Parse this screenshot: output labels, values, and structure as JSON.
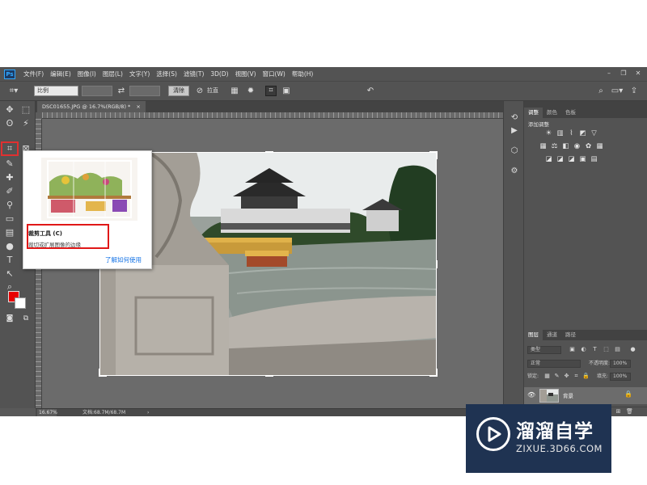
{
  "menubar": {
    "logo": "Ps",
    "items": [
      "文件(F)",
      "编辑(E)",
      "图像(I)",
      "图层(L)",
      "文字(Y)",
      "选择(S)",
      "滤镜(T)",
      "3D(D)",
      "视图(V)",
      "窗口(W)",
      "帮助(H)"
    ]
  },
  "options": {
    "ratio_select": "比例",
    "clear_button": "清除",
    "straighten_label": "拉直"
  },
  "document": {
    "tab_title": "DSC01655.JPG @ 16.7%(RGB/8) *",
    "close_glyph": "×"
  },
  "status": {
    "zoom": "16.67%",
    "doc_info": "文档:68.7M/68.7M",
    "arrow": "›"
  },
  "tooltip": {
    "title": "裁剪工具 (C)",
    "description": "裁切或扩展图像的边缘",
    "link": "了解如何使用"
  },
  "panels": {
    "adjust_tabs": [
      "调整",
      "颜色",
      "色板"
    ],
    "adjust_label": "添加调整",
    "layer_tabs": [
      "图层",
      "通道",
      "路径"
    ],
    "kind_select": "类型",
    "blend_select": "正常",
    "opacity_label": "不透明度:",
    "opacity_value": "100%",
    "lock_label": "锁定:",
    "fill_label": "填充:",
    "fill_value": "100%",
    "layer_name": "背景"
  },
  "watermark": {
    "title": "溜溜自学",
    "url": "ZIXUE.3D66.COM"
  },
  "colors": {
    "app_bg": "#535353",
    "canvas_bg": "#6b6b6b",
    "highlight_red": "#e01818",
    "foreground_swatch": "#e80000",
    "background_swatch": "#ffffff",
    "link_blue": "#1473e6",
    "watermark_bg": "#1f3352"
  }
}
